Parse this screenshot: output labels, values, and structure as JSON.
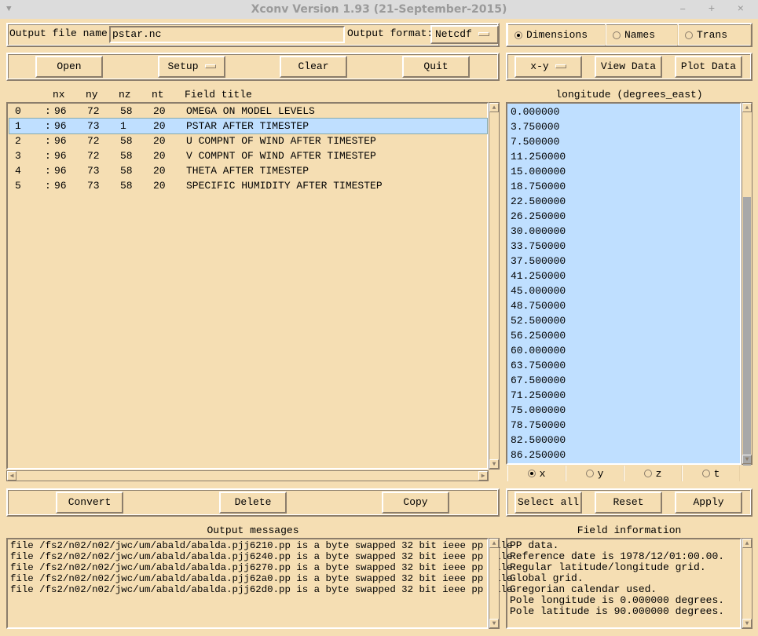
{
  "window": {
    "title": "Xconv Version 1.93 (21-September-2015)",
    "controls": "– + ×"
  },
  "top": {
    "output_file_label": "Output file name:",
    "output_file_value": "pstar.nc",
    "output_format_label": "Output format:",
    "output_format_value": "Netcdf"
  },
  "mode_radios": [
    {
      "label": "Dimensions",
      "selected": true
    },
    {
      "label": "Names",
      "selected": false
    },
    {
      "label": "Trans",
      "selected": false
    }
  ],
  "toolbar": {
    "open": "Open",
    "setup": "Setup",
    "clear": "Clear",
    "quit": "Quit"
  },
  "plot_toolbar": {
    "plot_type": "x-y",
    "view_data": "View Data",
    "plot_data": "Plot Data"
  },
  "fields": {
    "headers": {
      "nx": "nx",
      "ny": "ny",
      "nz": "nz",
      "nt": "nt",
      "title": "Field title"
    },
    "rows": [
      {
        "idx": "0",
        "nx": "96",
        "ny": "72",
        "nz": "58",
        "nt": "20",
        "title": "OMEGA ON MODEL LEVELS",
        "selected": false
      },
      {
        "idx": "1",
        "nx": "96",
        "ny": "73",
        "nz": "1",
        "nt": "20",
        "title": "PSTAR AFTER TIMESTEP",
        "selected": true
      },
      {
        "idx": "2",
        "nx": "96",
        "ny": "72",
        "nz": "58",
        "nt": "20",
        "title": "U COMPNT OF WIND AFTER TIMESTEP",
        "selected": false
      },
      {
        "idx": "3",
        "nx": "96",
        "ny": "72",
        "nz": "58",
        "nt": "20",
        "title": "V COMPNT OF WIND AFTER TIMESTEP",
        "selected": false
      },
      {
        "idx": "4",
        "nx": "96",
        "ny": "73",
        "nz": "58",
        "nt": "20",
        "title": "THETA AFTER TIMESTEP",
        "selected": false
      },
      {
        "idx": "5",
        "nx": "96",
        "ny": "73",
        "nz": "58",
        "nt": "20",
        "title": "SPECIFIC HUMIDITY AFTER TIMESTEP",
        "selected": false
      }
    ]
  },
  "dimension": {
    "title": "longitude (degrees_east)",
    "values": [
      "0.000000",
      "3.750000",
      "7.500000",
      "11.250000",
      "15.000000",
      "18.750000",
      "22.500000",
      "26.250000",
      "30.000000",
      "33.750000",
      "37.500000",
      "41.250000",
      "45.000000",
      "48.750000",
      "52.500000",
      "56.250000",
      "60.000000",
      "63.750000",
      "67.500000",
      "71.250000",
      "75.000000",
      "78.750000",
      "82.500000",
      "86.250000"
    ]
  },
  "axis_radios": [
    {
      "label": "x",
      "selected": true
    },
    {
      "label": "y",
      "selected": false
    },
    {
      "label": "z",
      "selected": false
    },
    {
      "label": "t",
      "selected": false
    }
  ],
  "actions": {
    "convert": "Convert",
    "delete": "Delete",
    "copy": "Copy",
    "select_all": "Select all",
    "reset": "Reset",
    "apply": "Apply"
  },
  "output_messages": {
    "title": "Output messages",
    "lines": [
      "file /fs2/n02/n02/jwc/um/abald/abalda.pjj6210.pp is a byte swapped 32 bit ieee pp file",
      "file /fs2/n02/n02/jwc/um/abald/abalda.pjj6240.pp is a byte swapped 32 bit ieee pp file",
      "file /fs2/n02/n02/jwc/um/abald/abalda.pjj6270.pp is a byte swapped 32 bit ieee pp file",
      "file /fs2/n02/n02/jwc/um/abald/abalda.pjj62a0.pp is a byte swapped 32 bit ieee pp file",
      "file /fs2/n02/n02/jwc/um/abald/abalda.pjj62d0.pp is a byte swapped 32 bit ieee pp file"
    ]
  },
  "field_information": {
    "title": "Field information",
    "lines": [
      "PP data.",
      "Reference date is 1978/12/01:00.00.",
      "Regular latitude/longitude grid.",
      "Global grid.",
      "Gregorian calendar used.",
      "Pole longitude is 0.000000 degrees.",
      "Pole latitude is 90.000000 degrees."
    ]
  }
}
